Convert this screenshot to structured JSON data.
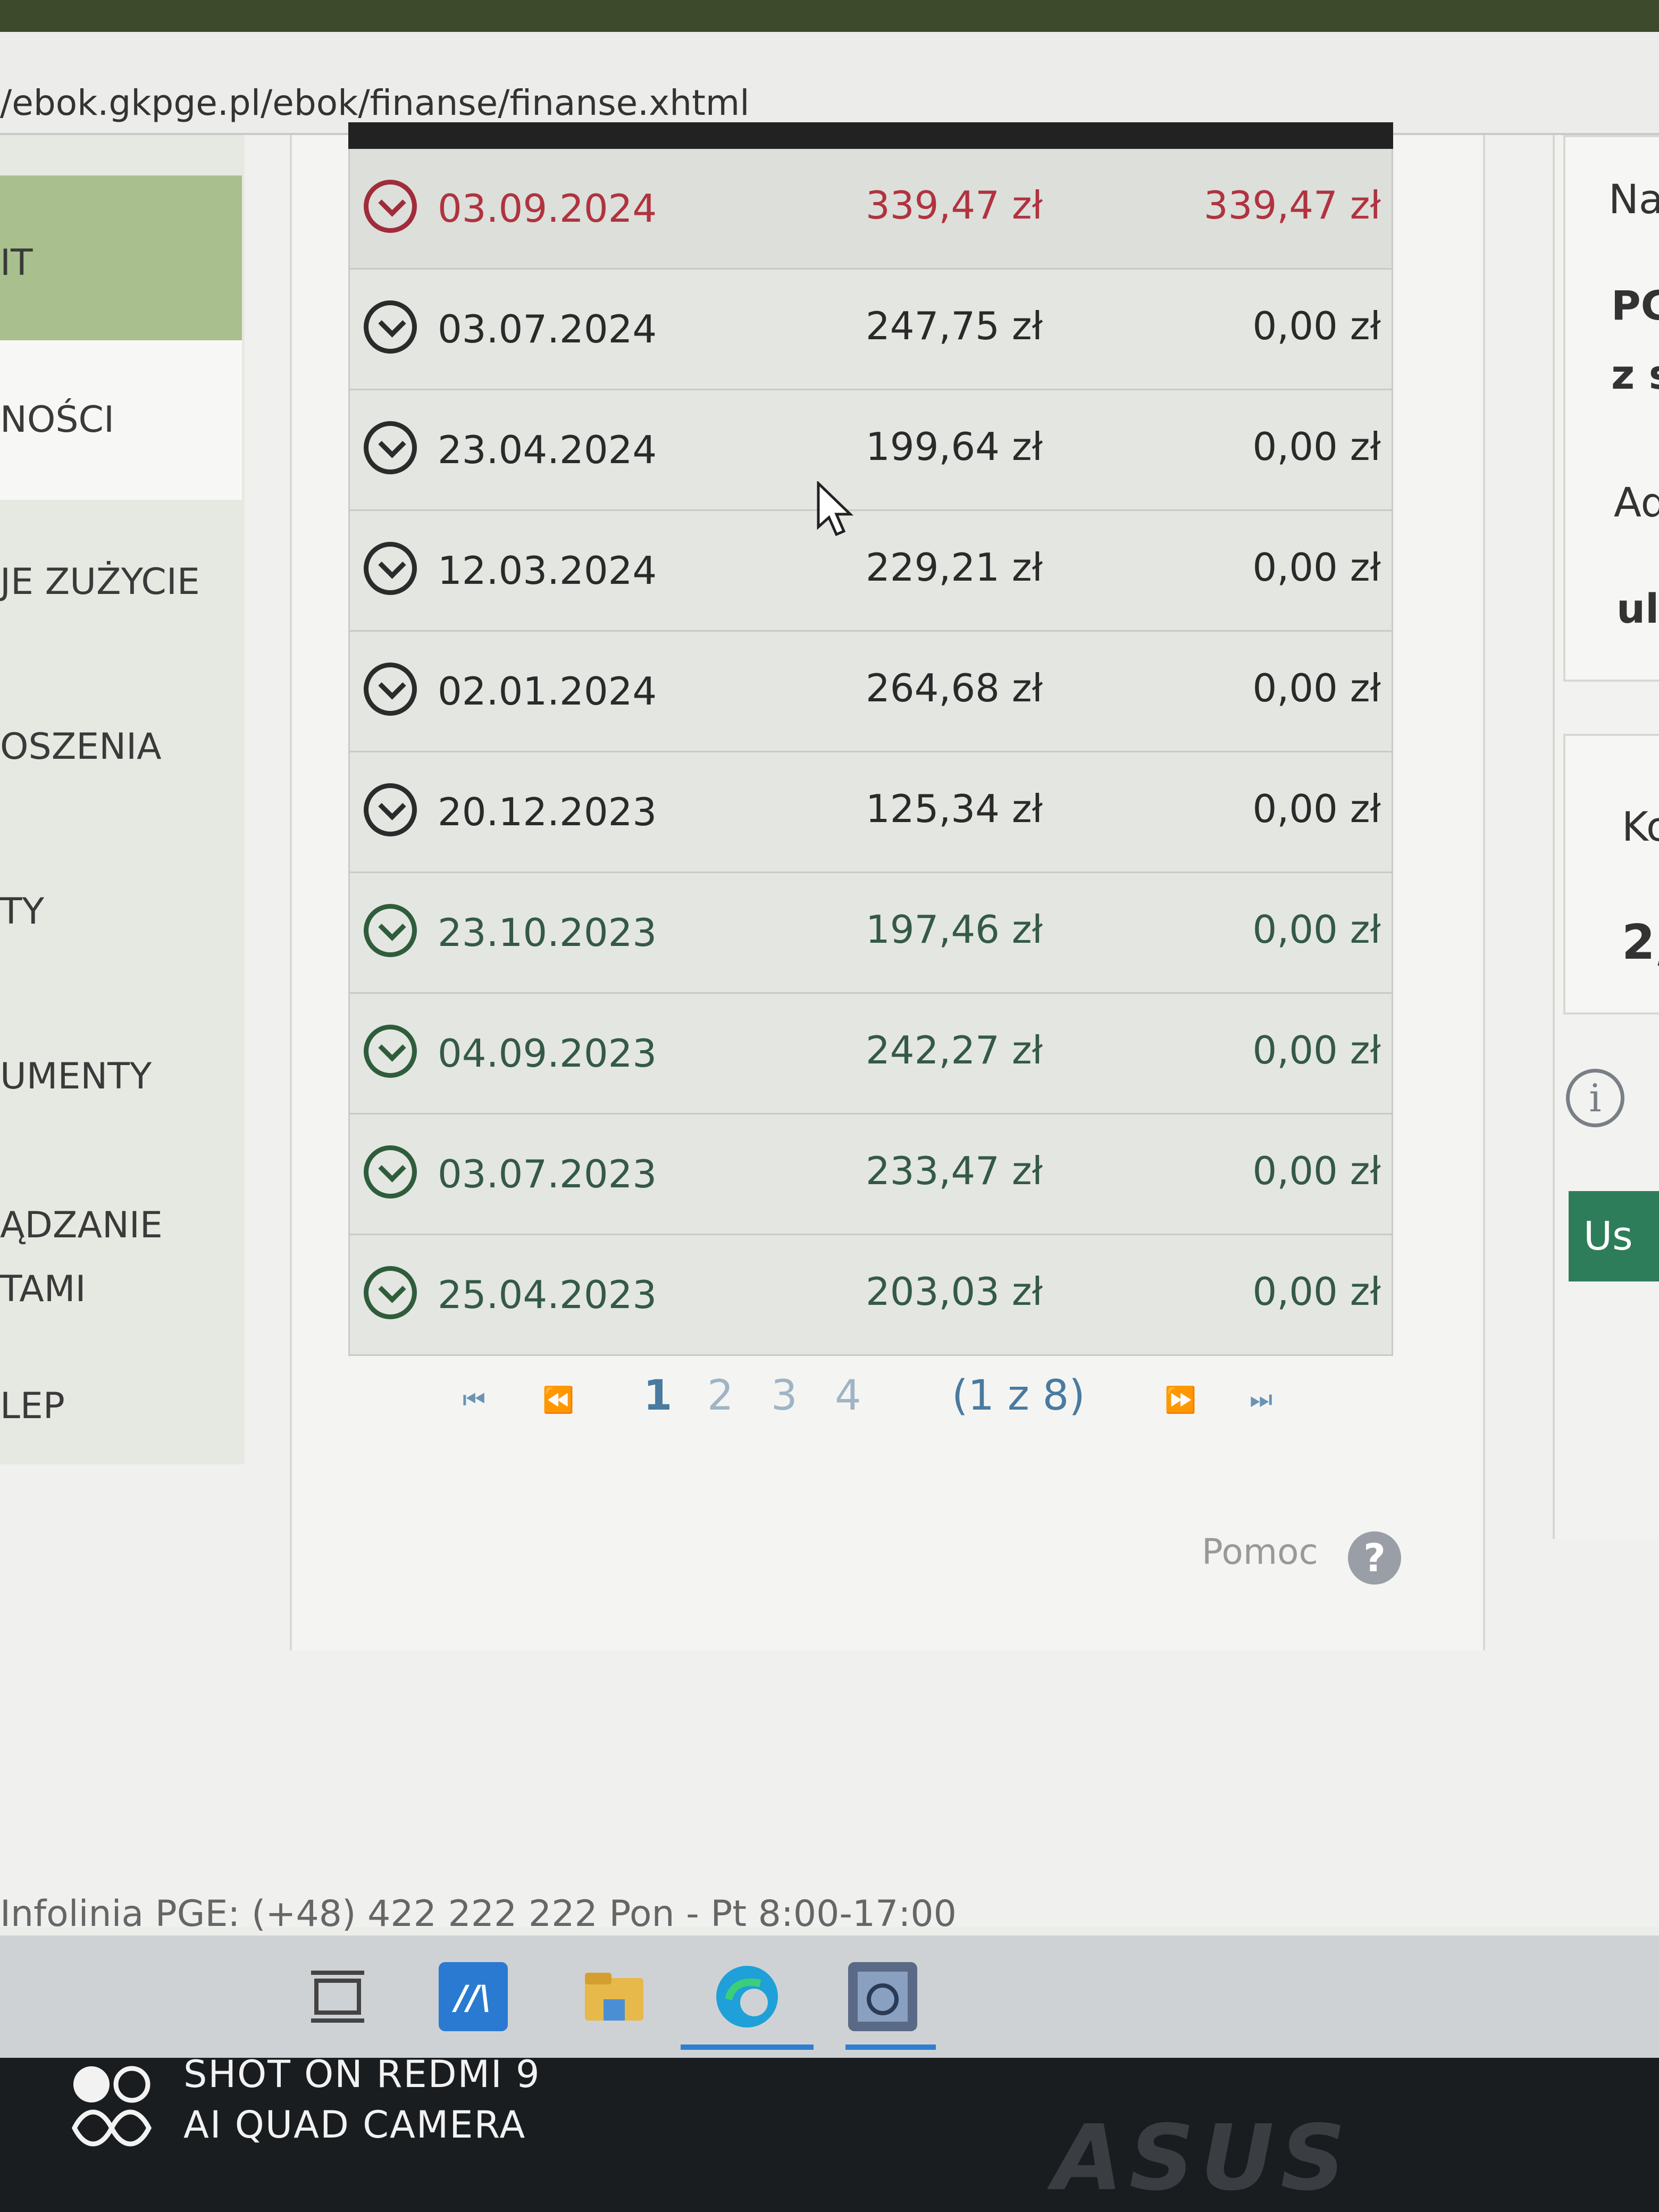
{
  "browser": {
    "url": "/ebok.gkpge.pl/ebok/finanse/finanse.xhtml"
  },
  "sidebar": {
    "items": [
      {
        "label": "IT"
      },
      {
        "label": "NOŚCI"
      },
      {
        "label": "JE ZUŻYCIE"
      },
      {
        "label": "OSZENIA"
      },
      {
        "label": "TY"
      },
      {
        "label": "UMENTY"
      },
      {
        "label": "ĄDZANIE"
      },
      {
        "label": "TAMI"
      },
      {
        "label": "LEP"
      }
    ]
  },
  "table": {
    "rows": [
      {
        "date": "03.09.2024",
        "amount": "339,47 zł",
        "due": "339,47 zł",
        "status": "overdue"
      },
      {
        "date": "03.07.2024",
        "amount": "247,75 zł",
        "due": "0,00 zł",
        "status": "paid"
      },
      {
        "date": "23.04.2024",
        "amount": "199,64 zł",
        "due": "0,00 zł",
        "status": "paid"
      },
      {
        "date": "12.03.2024",
        "amount": "229,21 zł",
        "due": "0,00 zł",
        "status": "paid"
      },
      {
        "date": "02.01.2024",
        "amount": "264,68 zł",
        "due": "0,00 zł",
        "status": "paid"
      },
      {
        "date": "20.12.2023",
        "amount": "125,34 zł",
        "due": "0,00 zł",
        "status": "paid"
      },
      {
        "date": "23.10.2023",
        "amount": "197,46 zł",
        "due": "0,00 zł",
        "status": "paid"
      },
      {
        "date": "04.09.2023",
        "amount": "242,27 zł",
        "due": "0,00 zł",
        "status": "paid"
      },
      {
        "date": "03.07.2023",
        "amount": "233,47 zł",
        "due": "0,00 zł",
        "status": "paid"
      },
      {
        "date": "25.04.2023",
        "amount": "203,03 zł",
        "due": "0,00 zł",
        "status": "paid"
      }
    ]
  },
  "pager": {
    "pages": [
      "1",
      "2",
      "3",
      "4"
    ],
    "current": "1",
    "summary": "(1 z 8)"
  },
  "help": {
    "label": "Pomoc",
    "icon_glyph": "?"
  },
  "right_panel": {
    "texts": [
      "Na",
      "PG",
      "z s",
      "Ad",
      "ul",
      "Ko",
      "2,"
    ],
    "info_glyph": "i",
    "button_label": "Us"
  },
  "footer": {
    "text": "Infolinia PGE: (+48) 422 222 222  Pon - Pt  8:00-17:00"
  },
  "watermark": {
    "line1": "SHOT ON REDMI 9",
    "line2": "AI QUAD CAMERA"
  },
  "device_brand": "ASUS",
  "colors": {
    "overdue": "#b0333f",
    "paid": "#345a46",
    "sidebar_active": "#a9c08e",
    "button": "#2e7d5a",
    "link": "#4a7aa0"
  }
}
